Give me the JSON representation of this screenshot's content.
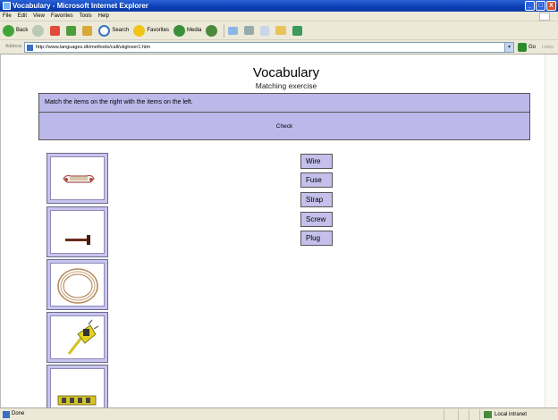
{
  "window": {
    "title": "Vocabulary - Microsoft Internet Explorer",
    "buttons": [
      "_",
      "□",
      "X"
    ]
  },
  "menu": [
    "File",
    "Edit",
    "View",
    "Favorites",
    "Tools",
    "Help"
  ],
  "toolbar": {
    "back": "Back",
    "search": "Search",
    "favorites": "Favorites",
    "media": "Media"
  },
  "address": {
    "label": "Address",
    "url": "http://www.languages.dk/methods/call/ukgloser1.htm",
    "go": "Go",
    "links": "Links"
  },
  "page": {
    "title": "Vocabulary",
    "subtitle": "Matching exercise",
    "instruction": "Match the items on the right with the items on the left.",
    "check": "Check"
  },
  "pictures": [
    "fuse-picture",
    "screw-picture",
    "wire-picture",
    "plug-picture",
    "strap-picture"
  ],
  "words": [
    "Wire",
    "Fuse",
    "Strap",
    "Screw",
    "Plug"
  ],
  "status": {
    "text": "Done",
    "zone": "Local intranet"
  },
  "colors": {
    "panel": "#bdb8ea",
    "word_button": "#c4bfeb",
    "titlebar": "#0a3fb4"
  }
}
